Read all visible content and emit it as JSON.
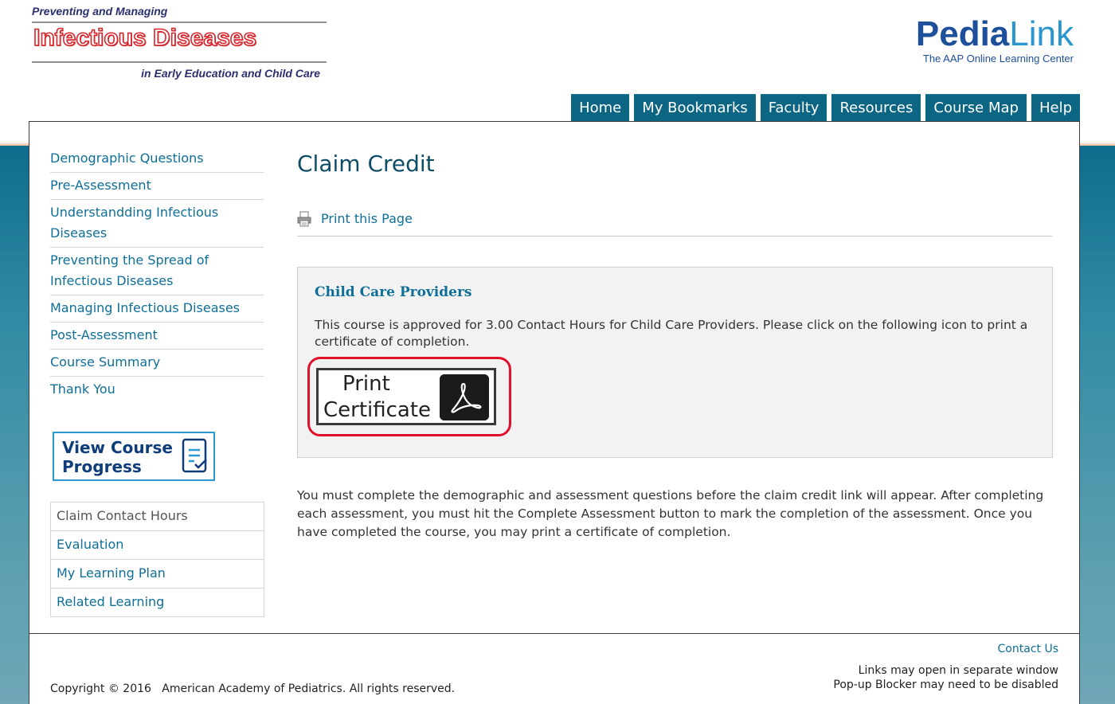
{
  "header": {
    "course_top": "Preventing and Managing",
    "course_title": "Infectious Diseases",
    "course_sub": "in Early Education and Child Care",
    "brand_bold": "Pedia",
    "brand_light": "Link",
    "brand_tag": "The AAP Online Learning Center"
  },
  "nav": {
    "items": [
      "Home",
      "My Bookmarks",
      "Faculty",
      "Resources",
      "Course Map",
      "Help"
    ]
  },
  "sidebar": {
    "items": [
      "Demographic Questions",
      "Pre-Assessment",
      "Understandding Infectious Diseases",
      "Preventing the Spread of Infectious Diseases",
      "Managing Infectious Diseases",
      "Post-Assessment",
      "Course Summary",
      "Thank You"
    ],
    "progress_button": "View Course Progress",
    "links": [
      "Claim Contact Hours",
      "Evaluation",
      "My Learning Plan",
      "Related Learning"
    ]
  },
  "main": {
    "title": "Claim Credit",
    "print_page": "Print this Page",
    "box_heading": "Child Care Providers",
    "box_text": "This course is approved for 3.00 Contact Hours for Child Care Providers. Please click on the following icon to print a certificate of completion.",
    "cert_line1": "Print",
    "cert_line2": "Certificate",
    "note": "You must complete the demographic and assessment questions before the claim credit link will appear. After completing each assessment, you must hit the Complete Assessment button to mark the completion of the assessment. Once you have completed the course, you may print a certificate of completion."
  },
  "footer": {
    "contact": "Contact Us",
    "window_note_1": "Links may open in separate window",
    "window_note_2": "Pop-up Blocker may need to be disabled",
    "copyright": "Copyright © 2016   American Academy of Pediatrics. All rights reserved."
  },
  "colors": {
    "accent": "#0d6584",
    "link": "#0e6f97",
    "highlight": "#e0102a"
  },
  "icons": [
    "printer-icon",
    "checklist-icon",
    "pdf-icon"
  ]
}
